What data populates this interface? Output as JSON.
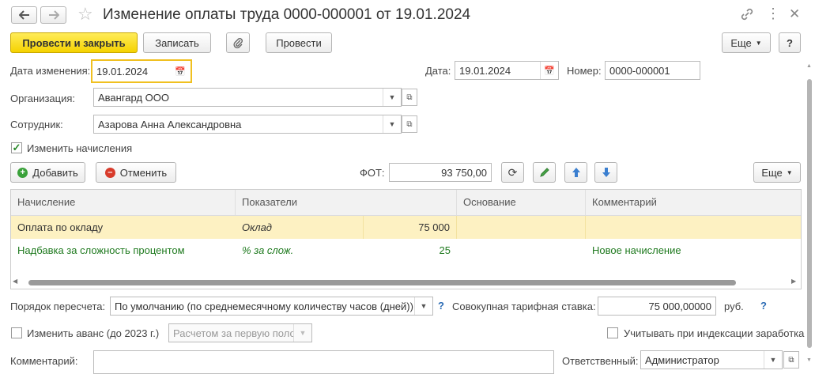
{
  "window": {
    "title": "Изменение оплаты труда 0000-000001 от 19.01.2024"
  },
  "toolbar": {
    "post_close_label": "Провести и закрыть",
    "save_label": "Записать",
    "post_label": "Провести",
    "more_label": "Еще",
    "help_label": "?"
  },
  "header": {
    "change_date_label": "Дата изменения:",
    "change_date_value": "19.01.2024",
    "date_label": "Дата:",
    "date_value": "19.01.2024",
    "number_label": "Номер:",
    "number_value": "0000-000001",
    "org_label": "Организация:",
    "org_value": "Авангард ООО",
    "employee_label": "Сотрудник:",
    "employee_value": "Азарова Анна Александровна",
    "change_accruals_label": "Изменить начисления"
  },
  "accruals": {
    "add_label": "Добавить",
    "cancel_label": "Отменить",
    "fot_label": "ФОТ:",
    "fot_value": "93 750,00",
    "more_label": "Еще",
    "columns": [
      "Начисление",
      "Показатели",
      "Основание",
      "Комментарий"
    ],
    "rows": [
      {
        "accrual": "Оплата по окладу",
        "indicator": "Оклад",
        "value": "75 000",
        "basis": "",
        "comment": ""
      },
      {
        "accrual": "Надбавка за сложность процентом",
        "indicator": "% за слож.",
        "value": "25",
        "basis": "",
        "comment": "Новое начисление"
      }
    ]
  },
  "footer": {
    "recalc_label": "Порядок пересчета:",
    "recalc_value": "По умолчанию (по среднемесячному количеству часов (дней))",
    "rate_label": "Совокупная тарифная ставка:",
    "rate_value": "75 000,00000",
    "rate_unit": "руб.",
    "advance_label": "Изменить аванс (до 2023 г.)",
    "advance_value": "Расчетом за первую полов",
    "indexation_label": "Учитывать при индексации заработка",
    "comment_label": "Комментарий:",
    "comment_value": "",
    "responsible_label": "Ответственный:",
    "responsible_value": "Администратор"
  },
  "colors": {
    "primary_button": "#f5d200",
    "selected_row": "#fdf1c2",
    "new_row_text": "#1f7a1f",
    "add_icon": "#3aa13a",
    "cancel_icon": "#d83b2b"
  }
}
